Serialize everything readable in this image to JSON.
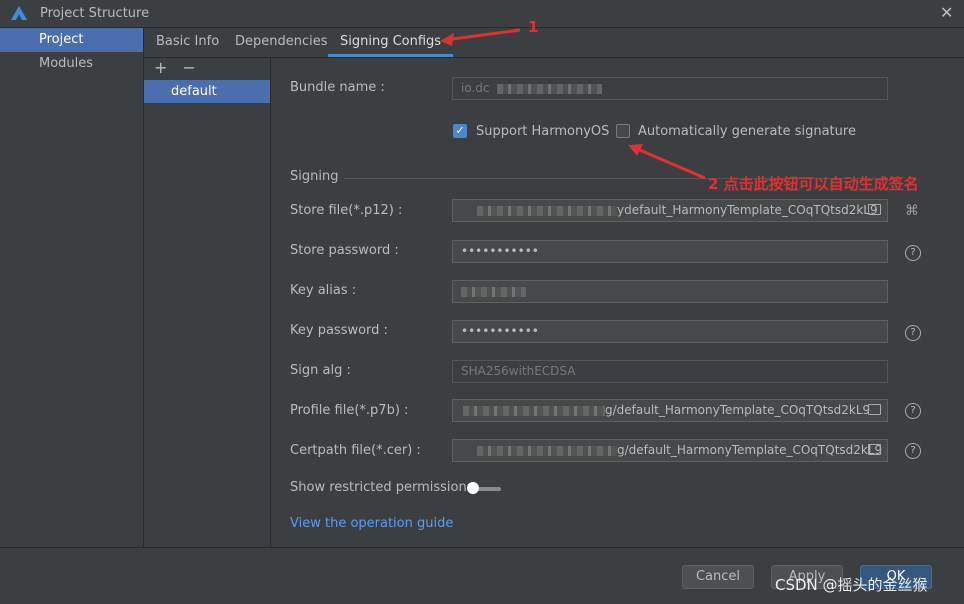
{
  "window": {
    "title": "Project Structure",
    "logo_icon": "harmony-logo-icon",
    "close_icon": "close-icon"
  },
  "nav": {
    "items": [
      {
        "label": "Project",
        "active": true
      },
      {
        "label": "Modules",
        "active": false
      }
    ]
  },
  "tabs": [
    {
      "label": "Basic Info"
    },
    {
      "label": "Dependencies"
    },
    {
      "label": "Signing Configs",
      "active": true
    }
  ],
  "configs": {
    "add_label": "+",
    "remove_label": "−",
    "items": [
      "default"
    ]
  },
  "form": {
    "bundle_name": {
      "label": "Bundle name :",
      "value": "io.dc"
    },
    "support_harmonyos": {
      "label": "Support HarmonyOS",
      "checked": true
    },
    "auto_sign": {
      "label": "Automatically generate signature",
      "checked": false
    },
    "signing_section": "Signing",
    "store_file": {
      "label": "Store file(*.p12) :",
      "value": "default_HarmonyTemplate_COqTQtsd2kL9",
      "prefix_char": "y"
    },
    "store_password": {
      "label": "Store password :",
      "value": "•••••••••••"
    },
    "key_alias": {
      "label": "Key alias :",
      "value": ""
    },
    "key_password": {
      "label": "Key password :",
      "value": "•••••••••••"
    },
    "sign_alg": {
      "label": "Sign alg :",
      "value": "SHA256withECDSA"
    },
    "profile_file": {
      "label": "Profile file(*.p7b) :",
      "value": "g/default_HarmonyTemplate_COqTQtsd2kL9"
    },
    "certpath_file": {
      "label": "Certpath file(*.cer) :",
      "value": "g/default_HarmonyTemplate_COqTQtsd2kL9"
    },
    "restricted": {
      "label": "Show restricted permissions",
      "on": false
    },
    "guide_link": "View the operation guide",
    "help_glyph": "?",
    "fingerprint_glyph": "⌘"
  },
  "buttons": {
    "cancel": "Cancel",
    "apply": "Apply",
    "ok": "OK"
  },
  "annotations": {
    "one": "1",
    "two": "2 点击此按钮可以自动生成签名",
    "color": "#e03030"
  },
  "watermark": "CSDN @摇头的金丝猴",
  "colors": {
    "accent": "#4b6eaf",
    "link": "#589df6",
    "annotation": "#e03030"
  }
}
